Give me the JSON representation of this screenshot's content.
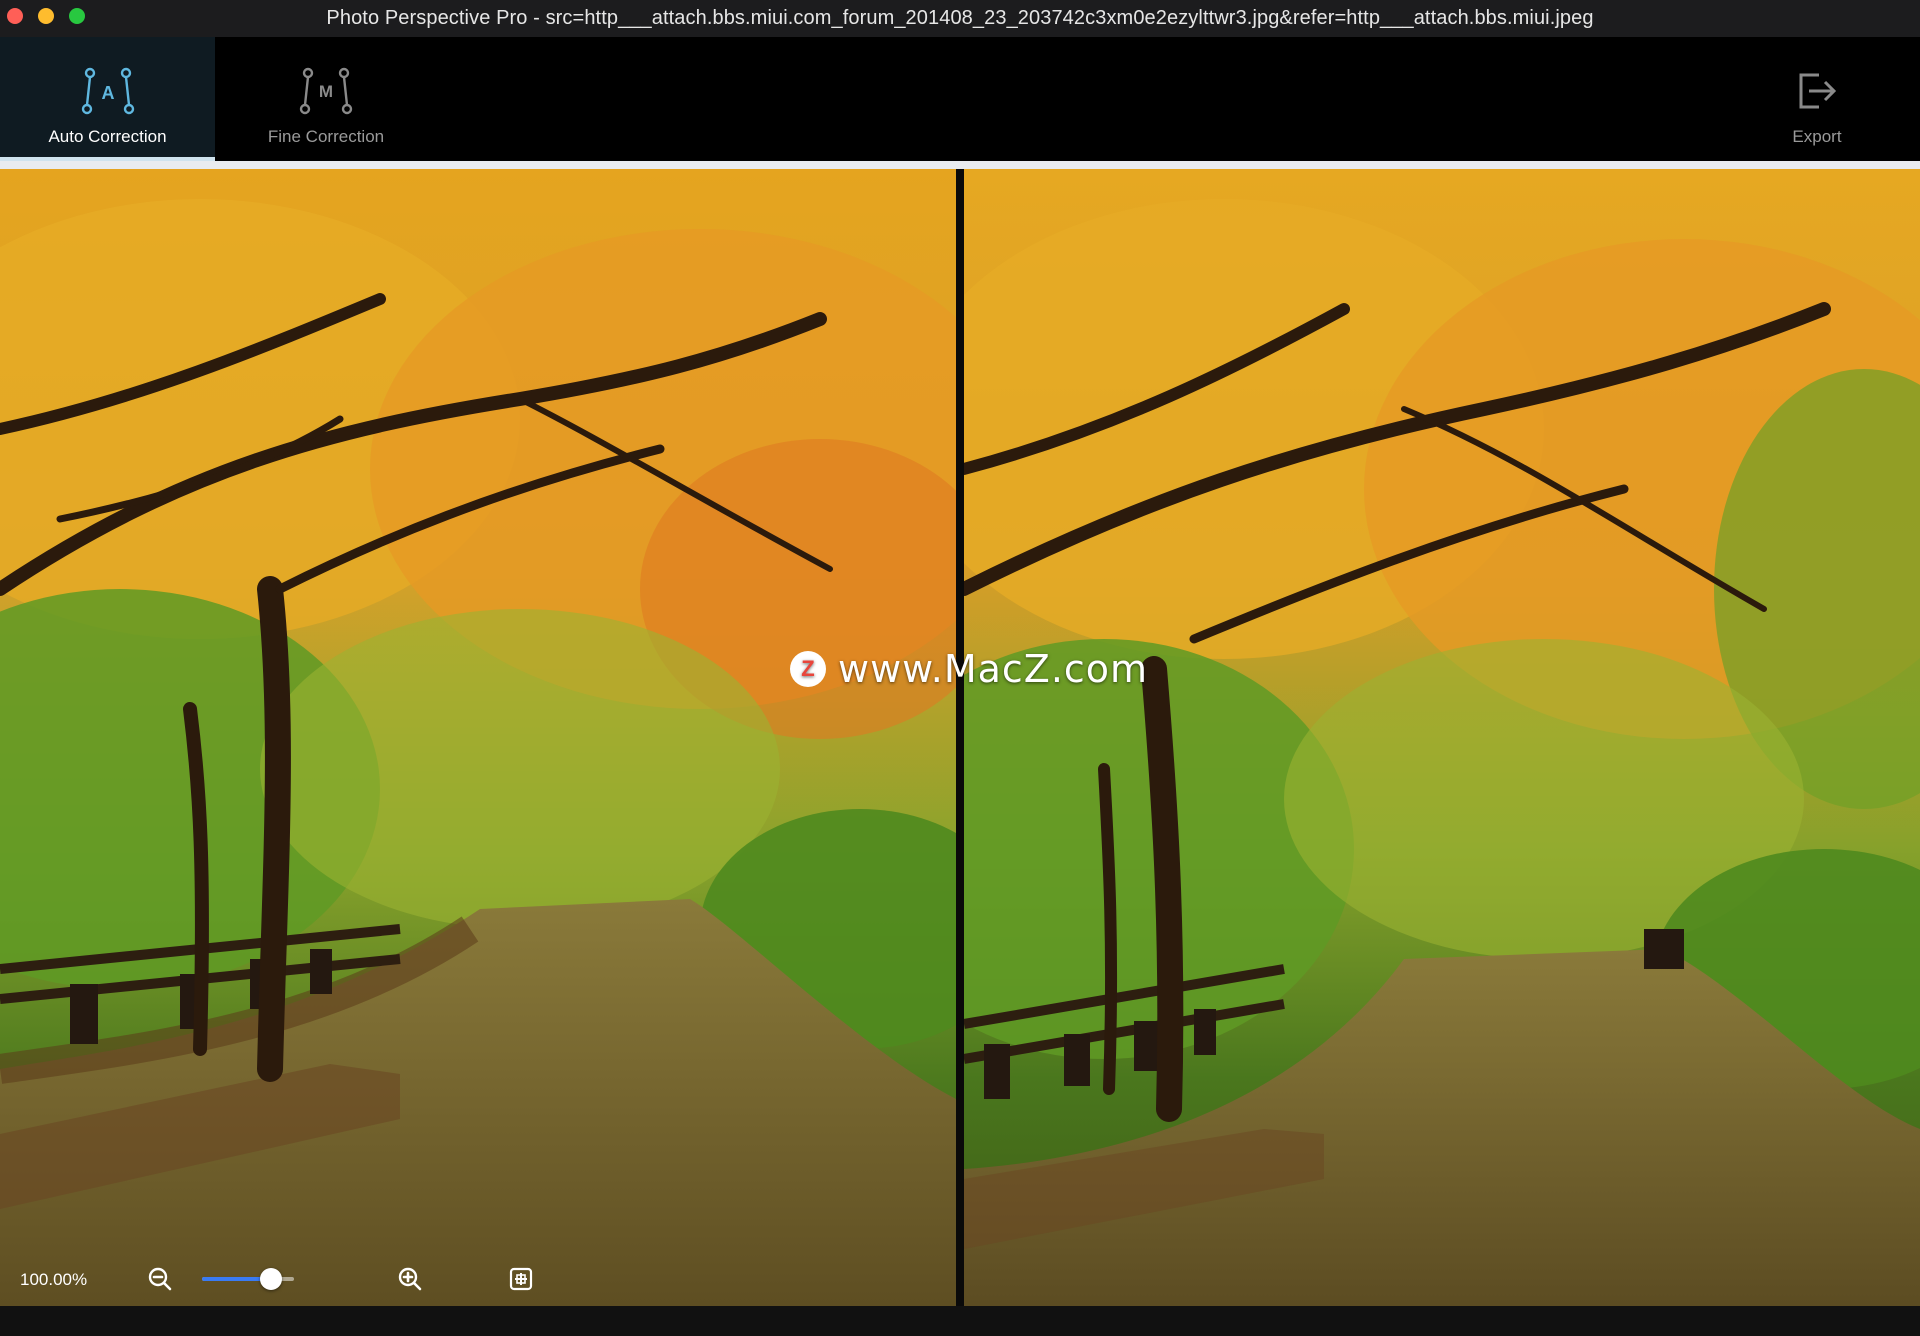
{
  "window": {
    "title": "Photo Perspective Pro - src=http___attach.bbs.miui.com_forum_201408_23_203742c3xm0e2ezylttwr3.jpg&refer=http___attach.bbs.miui.jpeg"
  },
  "toolbar": {
    "auto": {
      "label": "Auto Correction",
      "icon": "auto-correction-icon",
      "active": true
    },
    "fine": {
      "label": "Fine Correction",
      "icon": "fine-correction-icon",
      "active": false
    },
    "export": {
      "label": "Export",
      "icon": "export-icon"
    }
  },
  "watermark": {
    "logo_letter": "Z",
    "text": "www.MacZ.com"
  },
  "zoom": {
    "value_text": "100.00%",
    "slider_level": 0.75
  },
  "colors": {
    "accent": "#3a7bf2",
    "active_tab_bg": "#0f1b22",
    "icon_active": "#5fb8e0",
    "icon_inactive": "#8a8a8a"
  }
}
